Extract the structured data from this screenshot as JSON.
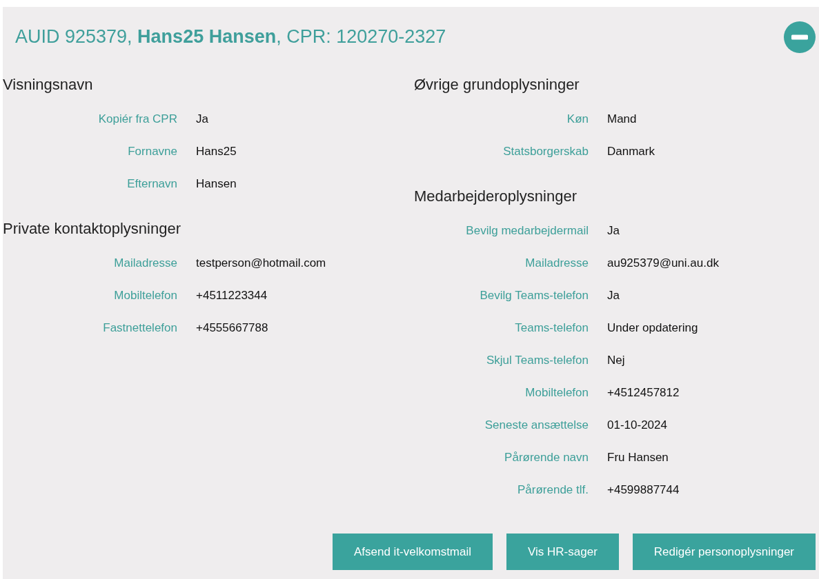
{
  "header": {
    "title": "AUID 925379, **Hans25 Hansen**, CPR: 120270-2327"
  },
  "columns": [
    [
      {
        "heading": "Visningsnavn",
        "fields": [
          {
            "label": "Kopiér fra CPR",
            "value": "Ja"
          },
          {
            "label": "Fornavne",
            "value": "Hans25"
          },
          {
            "label": "Efternavn",
            "value": "Hansen"
          }
        ]
      },
      {
        "heading": "Private kontaktoplysninger",
        "fields": [
          {
            "label": "Mailadresse",
            "value": "testperson@hotmail.com"
          },
          {
            "label": "Mobiltelefon",
            "value": "+4511223344"
          },
          {
            "label": "Fastnettelefon",
            "value": "+4555667788"
          }
        ]
      }
    ],
    [
      {
        "heading": "Øvrige grundoplysninger",
        "fields": [
          {
            "label": "Køn",
            "value": "Mand"
          },
          {
            "label": "Statsborgerskab",
            "value": "Danmark"
          }
        ]
      },
      {
        "heading": "Medarbejderoplysninger",
        "fields": [
          {
            "label": "Bevilg medarbejdermail",
            "value": "Ja"
          },
          {
            "label": "Mailadresse",
            "value": "au925379@uni.au.dk"
          },
          {
            "label": "Bevilg Teams-telefon",
            "value": "Ja"
          },
          {
            "label": "Teams-telefon",
            "value": "Under opdatering"
          },
          {
            "label": "Skjul Teams-telefon",
            "value": "Nej"
          },
          {
            "label": "Mobiltelefon",
            "value": "+4512457812"
          },
          {
            "label": "Seneste ansættelse",
            "value": "01-10-2024"
          },
          {
            "label": "Pårørende navn",
            "value": "Fru Hansen"
          },
          {
            "label": "Pårørende tlf.",
            "value": "+4599887744"
          }
        ]
      }
    ]
  ],
  "buttons": [
    "Afsend it-velkomstmail",
    "Vis HR-sager",
    "Redigér personoplysninger"
  ]
}
